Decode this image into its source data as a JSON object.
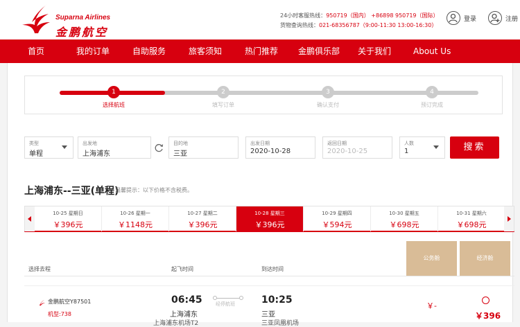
{
  "brand": {
    "name_en": "Suparna Airlines",
    "name_cn": "金鹏航空",
    "color": "#d7000f"
  },
  "hotline": {
    "line1_prefix": "24小时客服热线：",
    "line1_domestic": "950719（国内）",
    "line1_intl": "+86898 950719（国际）",
    "line2_prefix": "货物查询热线：",
    "line2_value": "021-68356787（9:00-11:30 13:00-16:30）"
  },
  "user": {
    "login_label": "登录",
    "register_label": "注册"
  },
  "nav": {
    "items": [
      "首页",
      "我的订单",
      "自助服务",
      "旅客须知",
      "热门推荐",
      "金鹏俱乐部",
      "关于我们",
      "About Us"
    ]
  },
  "steps": [
    {
      "num": "1",
      "label": "选择航班",
      "active": true
    },
    {
      "num": "2",
      "label": "填写订单",
      "active": false
    },
    {
      "num": "3",
      "label": "确认支付",
      "active": false
    },
    {
      "num": "4",
      "label": "预订完成",
      "active": false
    }
  ],
  "search": {
    "type_caption": "类型",
    "type_value": "单程",
    "from_caption": "出发地",
    "from_value": "上海浦东",
    "to_caption": "目的地",
    "to_value": "三亚",
    "depart_caption": "出发日期",
    "depart_value": "2020-10-28",
    "return_caption": "返回日期",
    "return_value": "2020-10-25",
    "pax_caption": "人数",
    "pax_value": "1",
    "button_label": "搜索"
  },
  "route": {
    "title": "上海浦东--三亚(单程)",
    "tip": "温馨提示：以下价格不含税费。"
  },
  "dates": [
    {
      "date": "10-25 星期日",
      "price": "￥396元",
      "selected": false
    },
    {
      "date": "10-26 星期一",
      "price": "￥1148元",
      "selected": false
    },
    {
      "date": "10-27 星期二",
      "price": "￥396元",
      "selected": false
    },
    {
      "date": "10-28 星期三",
      "price": "￥396元",
      "selected": true
    },
    {
      "date": "10-29 星期四",
      "price": "￥594元",
      "selected": false
    },
    {
      "date": "10-30 星期五",
      "price": "￥698元",
      "selected": false
    },
    {
      "date": "10-31 星期六",
      "price": "￥698元",
      "selected": false
    }
  ],
  "table": {
    "col_select": "选择去程",
    "col_depart": "起飞时间",
    "col_arrive": "到达时间",
    "cabin_public": "公务舱",
    "cabin_economy": "经济舱"
  },
  "flight": {
    "name": "金鹏航空Y87501",
    "model": "机型:738",
    "dep_time": "06:45",
    "dep_city": "上海浦东",
    "dep_airport": "上海浦东机场T2",
    "connector": "经停航班",
    "arr_time": "10:25",
    "arr_city": "三亚",
    "arr_airport": "三亚凤凰机场",
    "public_price": "￥-",
    "economy_price": "￥396"
  }
}
